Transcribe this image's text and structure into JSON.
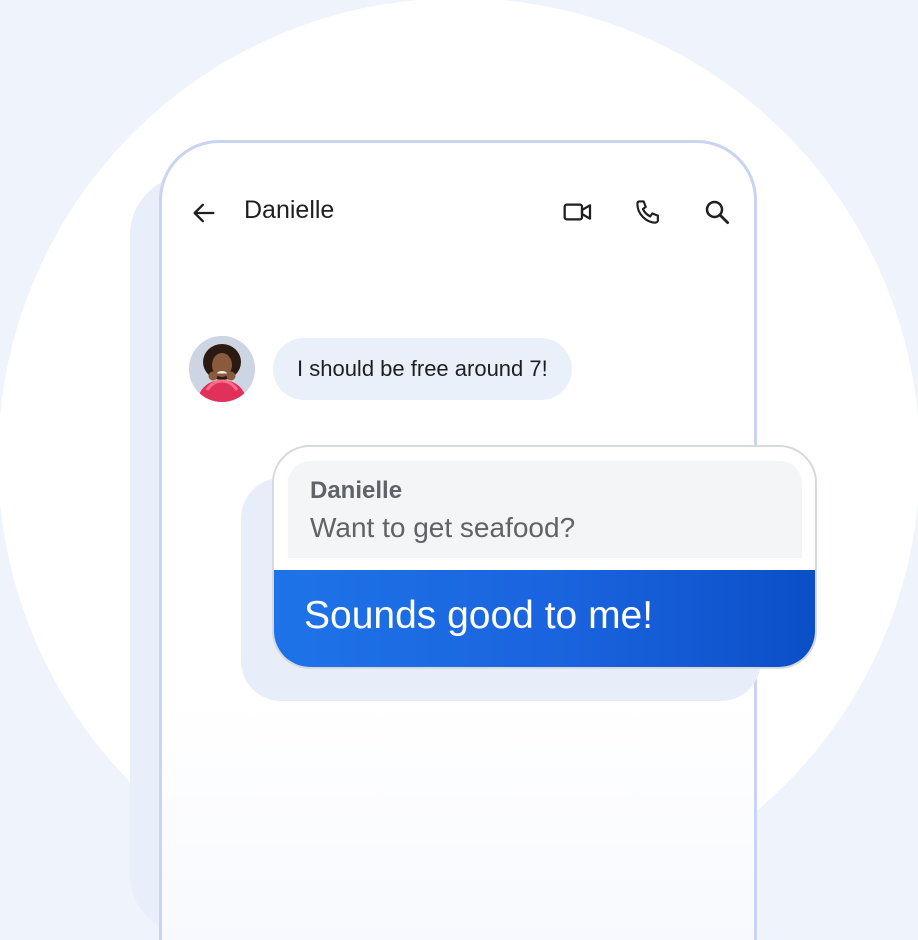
{
  "header": {
    "contact_name": "Danielle",
    "icons": [
      "back-arrow-icon",
      "video-call-icon",
      "phone-icon",
      "search-icon"
    ]
  },
  "messages": {
    "incoming": {
      "text": "I should be free around 7!"
    },
    "reply": {
      "quoted_name": "Danielle",
      "quoted_text": "Want to get seafood?",
      "text": "Sounds good to me!"
    }
  },
  "colors": {
    "accent": "#1a63de",
    "incoming_bubble": "#eaf0fa",
    "phone_outline": "#c9d3f2",
    "background": "#eef3fc"
  }
}
